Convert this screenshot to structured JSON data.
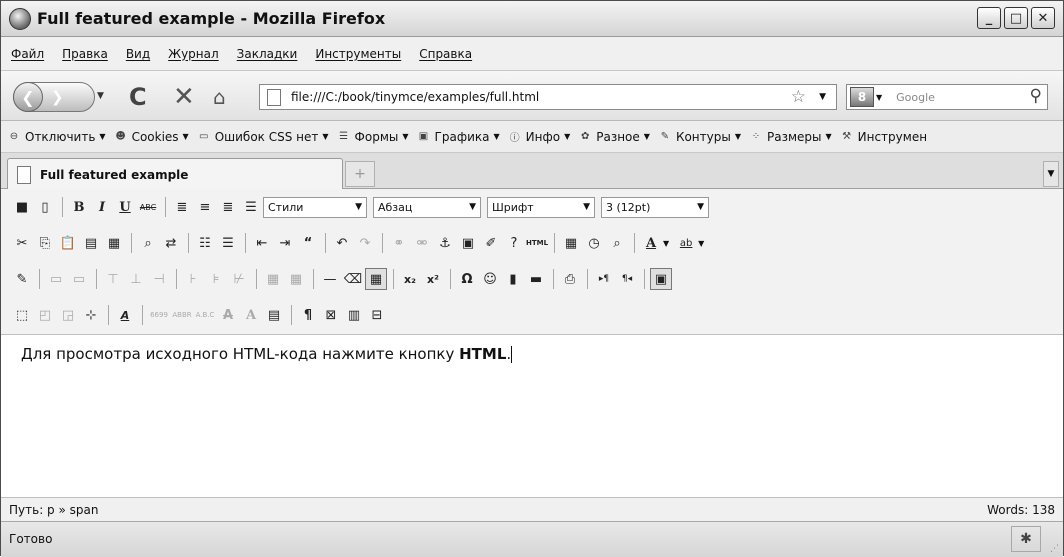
{
  "window": {
    "title": "Full featured example - Mozilla Firefox",
    "controls": [
      "_",
      "□",
      "✕"
    ]
  },
  "menu": [
    "Файл",
    "Правка",
    "Вид",
    "Журнал",
    "Закладки",
    "Инструменты",
    "Справка"
  ],
  "nav": {
    "url": "file:///C:/book/tinymce/examples/full.html",
    "search_placeholder": "Google",
    "search_engine_label": "8"
  },
  "devbar": [
    {
      "label": "Отключить",
      "icon": "disable-icon",
      "arrow": true
    },
    {
      "label": "Cookies",
      "icon": "cookies-icon",
      "arrow": true
    },
    {
      "label": "Ошибок CSS нет",
      "icon": "css-icon",
      "arrow": true
    },
    {
      "label": "Формы",
      "icon": "forms-icon",
      "arrow": true
    },
    {
      "label": "Графика",
      "icon": "images-icon",
      "arrow": true
    },
    {
      "label": "Инфо",
      "icon": "info-icon",
      "arrow": true
    },
    {
      "label": "Разное",
      "icon": "misc-icon",
      "arrow": true
    },
    {
      "label": "Контуры",
      "icon": "outline-icon",
      "arrow": true
    },
    {
      "label": "Размеры",
      "icon": "resize-icon",
      "arrow": true
    },
    {
      "label": "Инструмен",
      "icon": "tools-icon",
      "arrow": false
    }
  ],
  "tabs": [
    {
      "label": "Full featured example",
      "active": true
    }
  ],
  "editor": {
    "selects": {
      "styles": "Стили",
      "format": "Абзац",
      "font": "Шрифт",
      "size": "3 (12pt)"
    },
    "content_text": "Для просмотра исходного HTML-кода нажмите кнопку ",
    "content_strong": "HTML",
    "content_tail": ".",
    "path": "Путь: p » span",
    "words": "Words: 138"
  },
  "status": {
    "text": "Готово"
  }
}
